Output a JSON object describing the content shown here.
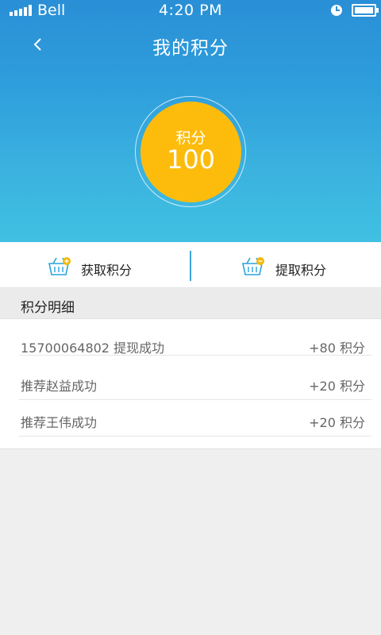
{
  "status_bar": {
    "carrier": "Bell",
    "time": "4:20 PM"
  },
  "nav": {
    "title": "我的积分"
  },
  "points": {
    "label": "积分",
    "value": "100"
  },
  "actions": {
    "earn_label": "获取积分",
    "redeem_label": "提取积分"
  },
  "details": {
    "header": "积分明细",
    "rows": [
      {
        "desc": "15700064802 提现成功",
        "amount": "+80 积分"
      },
      {
        "desc": "推荐赵益成功",
        "amount": "+20 积分"
      },
      {
        "desc": "推荐王伟成功",
        "amount": "+20 积分"
      }
    ]
  },
  "colors": {
    "header_top": "#2a8fd6",
    "header_bottom": "#40c0e2",
    "points_circle": "#fdbc0c",
    "divider": "#3aa6d8",
    "basket_icon": "#2aa3dc",
    "badge_icon": "#f5b800"
  }
}
